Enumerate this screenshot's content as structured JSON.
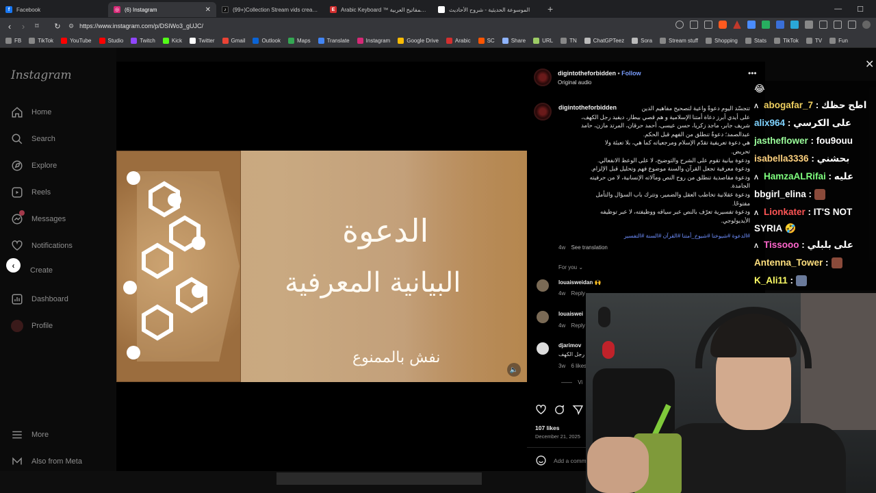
{
  "browser": {
    "tabs": [
      {
        "title": "Facebook",
        "icon": "facebook-icon",
        "color": "#1877f2",
        "active": false
      },
      {
        "title": "(6) Instagram",
        "icon": "instagram-icon",
        "color": "#d62976",
        "active": true
      },
      {
        "title": "(99+)Collection Stream vids created",
        "icon": "tiktok-icon",
        "color": "#111111",
        "active": false
      },
      {
        "title": "Arabic Keyboard ™ لوحة المفاتيح العربية",
        "icon": "arabic-keyboard-icon",
        "color": "#d32f2f",
        "active": false
      },
      {
        "title": "الموسوعة الحديثية - شروح الأحاديث",
        "icon": "page-icon",
        "color": "#ffffff",
        "active": false
      }
    ],
    "url": "https://www.instagram.com/p/DSIWo3_gUJC/",
    "bookmarks": [
      {
        "label": "FB",
        "color": "#888888"
      },
      {
        "label": "TikTok",
        "color": "#888888"
      },
      {
        "label": "YouTube",
        "color": "#ff0000"
      },
      {
        "label": "Studio",
        "color": "#ff0000"
      },
      {
        "label": "Twitch",
        "color": "#9146ff"
      },
      {
        "label": "Kick",
        "color": "#53fc18"
      },
      {
        "label": "Twitter",
        "color": "#ffffff"
      },
      {
        "label": "Gmail",
        "color": "#ea4335"
      },
      {
        "label": "Outlook",
        "color": "#0a64d6"
      },
      {
        "label": "Maps",
        "color": "#34a853"
      },
      {
        "label": "Translate",
        "color": "#4285f4"
      },
      {
        "label": "Instagram",
        "color": "#d62976"
      },
      {
        "label": "Google Drive",
        "color": "#fbbc04"
      },
      {
        "label": "Arabic",
        "color": "#d32f2f"
      },
      {
        "label": "SC",
        "color": "#ff5500"
      },
      {
        "label": "Share",
        "color": "#8fb4ff"
      },
      {
        "label": "URL",
        "color": "#9ccc65"
      },
      {
        "label": "TN",
        "color": "#888888"
      },
      {
        "label": "ChatGPTeez",
        "color": "#bbbbbb"
      },
      {
        "label": "Sora",
        "color": "#bbbbbb"
      },
      {
        "label": "Stream stuff",
        "color": "#888888"
      },
      {
        "label": "Shopping",
        "color": "#888888"
      },
      {
        "label": "Stats",
        "color": "#888888"
      },
      {
        "label": "TikTok",
        "color": "#888888"
      },
      {
        "label": "TV",
        "color": "#888888"
      },
      {
        "label": "Fun",
        "color": "#888888"
      }
    ]
  },
  "sidebar": {
    "logo": "Instagram",
    "items": [
      {
        "label": "Home",
        "icon": "home-icon"
      },
      {
        "label": "Search",
        "icon": "search-icon"
      },
      {
        "label": "Explore",
        "icon": "explore-icon"
      },
      {
        "label": "Reels",
        "icon": "reels-icon"
      },
      {
        "label": "Messages",
        "icon": "messages-icon"
      },
      {
        "label": "Notifications",
        "icon": "heart-icon"
      },
      {
        "label": "Create",
        "icon": "create-icon"
      },
      {
        "label": "Dashboard",
        "icon": "dashboard-icon"
      },
      {
        "label": "Profile",
        "icon": "profile-icon"
      }
    ],
    "bottom": [
      {
        "label": "More",
        "icon": "menu-icon"
      },
      {
        "label": "Also from Meta",
        "icon": "meta-icon"
      }
    ]
  },
  "post": {
    "author": "digintotheforbidden",
    "follow": "Follow",
    "audio": "Original audio",
    "caption_author": "digintotheforbidden",
    "caption_lines": [
      "تتجسّد اليوم دعوةٌ واعية لتصحيح مفاهيم الدين",
      "على أيدي أبرز دعاة أمتنا الإسلامية و هم قصي بيطار، ديفيد رجل الكهف،",
      "شريف جابر، ماجد زكريا، حسن عيسى، أحمد حرقان، المرتد مازن، حامد",
      "عبدالصمد؛ دعوةٌ تنطلق من الفهم قبل الحكم.",
      "هي دعوة تعريفية تقدّم الإسلام ومرجعياته كما هي، بلا تعبئة ولا",
      "تحريض.",
      "ودعوة بيانية تقوم على الشرح والتوضيح، لا على الوعظ الانفعالي.",
      "ودعوة معرفية تجعل القرآن والسنة موضوع فهم وتحليل قبل الإلزام.",
      "ودعوة مقاصدية تنطلق من روح النص ومآلاته الإنسانية، لا من حرفيته",
      "الجامدة.",
      "ودعوة عقلانية تخاطب العقل والضمير، وتترك باب السؤال والتأمل",
      "مفتوحًا.",
      "ودعوة تفسيرية تعرّف بالنص عبر سياقه ووظيفته، لا عبر توظيفه",
      "الأيديولوجي."
    ],
    "hashtags": "#الدعوة #شيوخنا #شيوخ_أمتنا #القرآن #السنة #التفسير",
    "caption_age": "4w",
    "see_translation": "See translation",
    "for_you": "For you",
    "comments": [
      {
        "user": "louaisweidan",
        "text": "🙌",
        "age": "4w",
        "reply": "Reply"
      },
      {
        "user": "louaiswei",
        "text": "",
        "age": "4w",
        "reply": "Reply"
      },
      {
        "user": "djarimov",
        "text": "رجل الكهف",
        "age": "3w",
        "likes": "6 likes"
      }
    ],
    "view_replies": "Vi",
    "likes": "107 likes",
    "date": "December 21, 2025",
    "add_comment": "Add a comm"
  },
  "media": {
    "title_line1": "الدعوة",
    "title_line2": "البيانية المعرفية",
    "signature": "نفش بالممنوع"
  },
  "chat": [
    {
      "text": "😂",
      "badge": "",
      "color": "#ffffff"
    },
    {
      "user": "abogafar_7",
      "text": ": اطح حظك",
      "badge": "Λ",
      "color": "#f0d060"
    },
    {
      "user": "alix964",
      "text": ": على الكرسي",
      "badge": "",
      "color": "#7fd3ff"
    },
    {
      "user": "jastheflower",
      "text": ": fou9ouu",
      "badge": "",
      "color": "#9cff9c"
    },
    {
      "user": "isabella3336",
      "text": ": بحشني",
      "badge": "",
      "color": "#ffd27f"
    },
    {
      "user": "HamzaALRifai",
      "text": ": عليه",
      "badge": "Λ",
      "color": "#7fff7f"
    },
    {
      "user": "bbgirl_elina",
      "text": ":",
      "badge": "",
      "color": "#ffffff"
    },
    {
      "user": "Lionkater",
      "text": ": IT'S NOT",
      "badge": "Λ",
      "color": "#ff5555"
    },
    {
      "user": "",
      "text": "SYRIA 🤣",
      "badge": "",
      "color": "#ffffff"
    },
    {
      "user": "Tissooo",
      "text": ": على بلبلي",
      "badge": "Λ",
      "color": "#ff66cc"
    },
    {
      "user": "Antenna_Tower",
      "text": ":",
      "badge": "",
      "color": "#ffe07f"
    },
    {
      "user": "K_Ali11",
      "text": ":",
      "badge": "",
      "color": "#ffff66"
    }
  ]
}
